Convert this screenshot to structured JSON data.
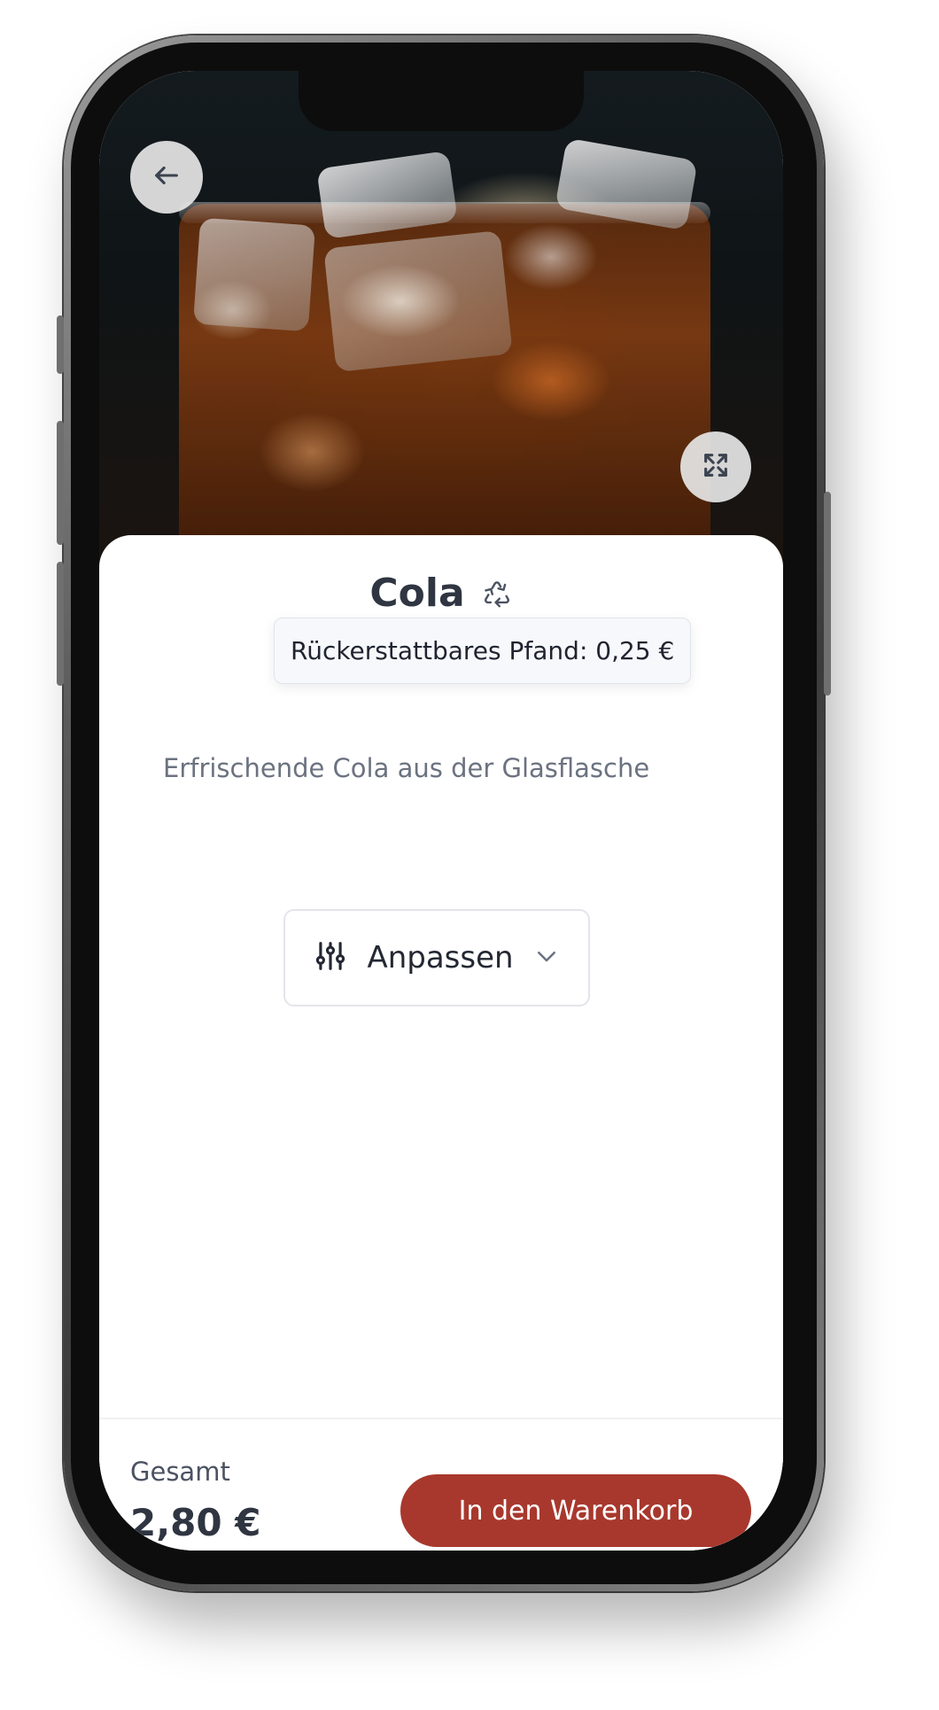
{
  "product": {
    "name": "Cola",
    "description": "Erfrischende Cola aus der Glasflasche",
    "deposit_tooltip": "Rückerstattbares Pfand: 0,25 €"
  },
  "actions": {
    "back_icon": "arrow-left-icon",
    "expand_icon": "expand-icon",
    "customize_label": "Anpassen",
    "customize_icon": "sliders-icon",
    "customize_chevron": "chevron-down-icon"
  },
  "footer": {
    "total_label": "Gesamt",
    "total_value": "2,80 €",
    "add_to_cart_label": "In den Warenkorb"
  },
  "colors": {
    "accent": "#a8382d",
    "title": "#2f3541",
    "muted_text": "#6b7280"
  }
}
